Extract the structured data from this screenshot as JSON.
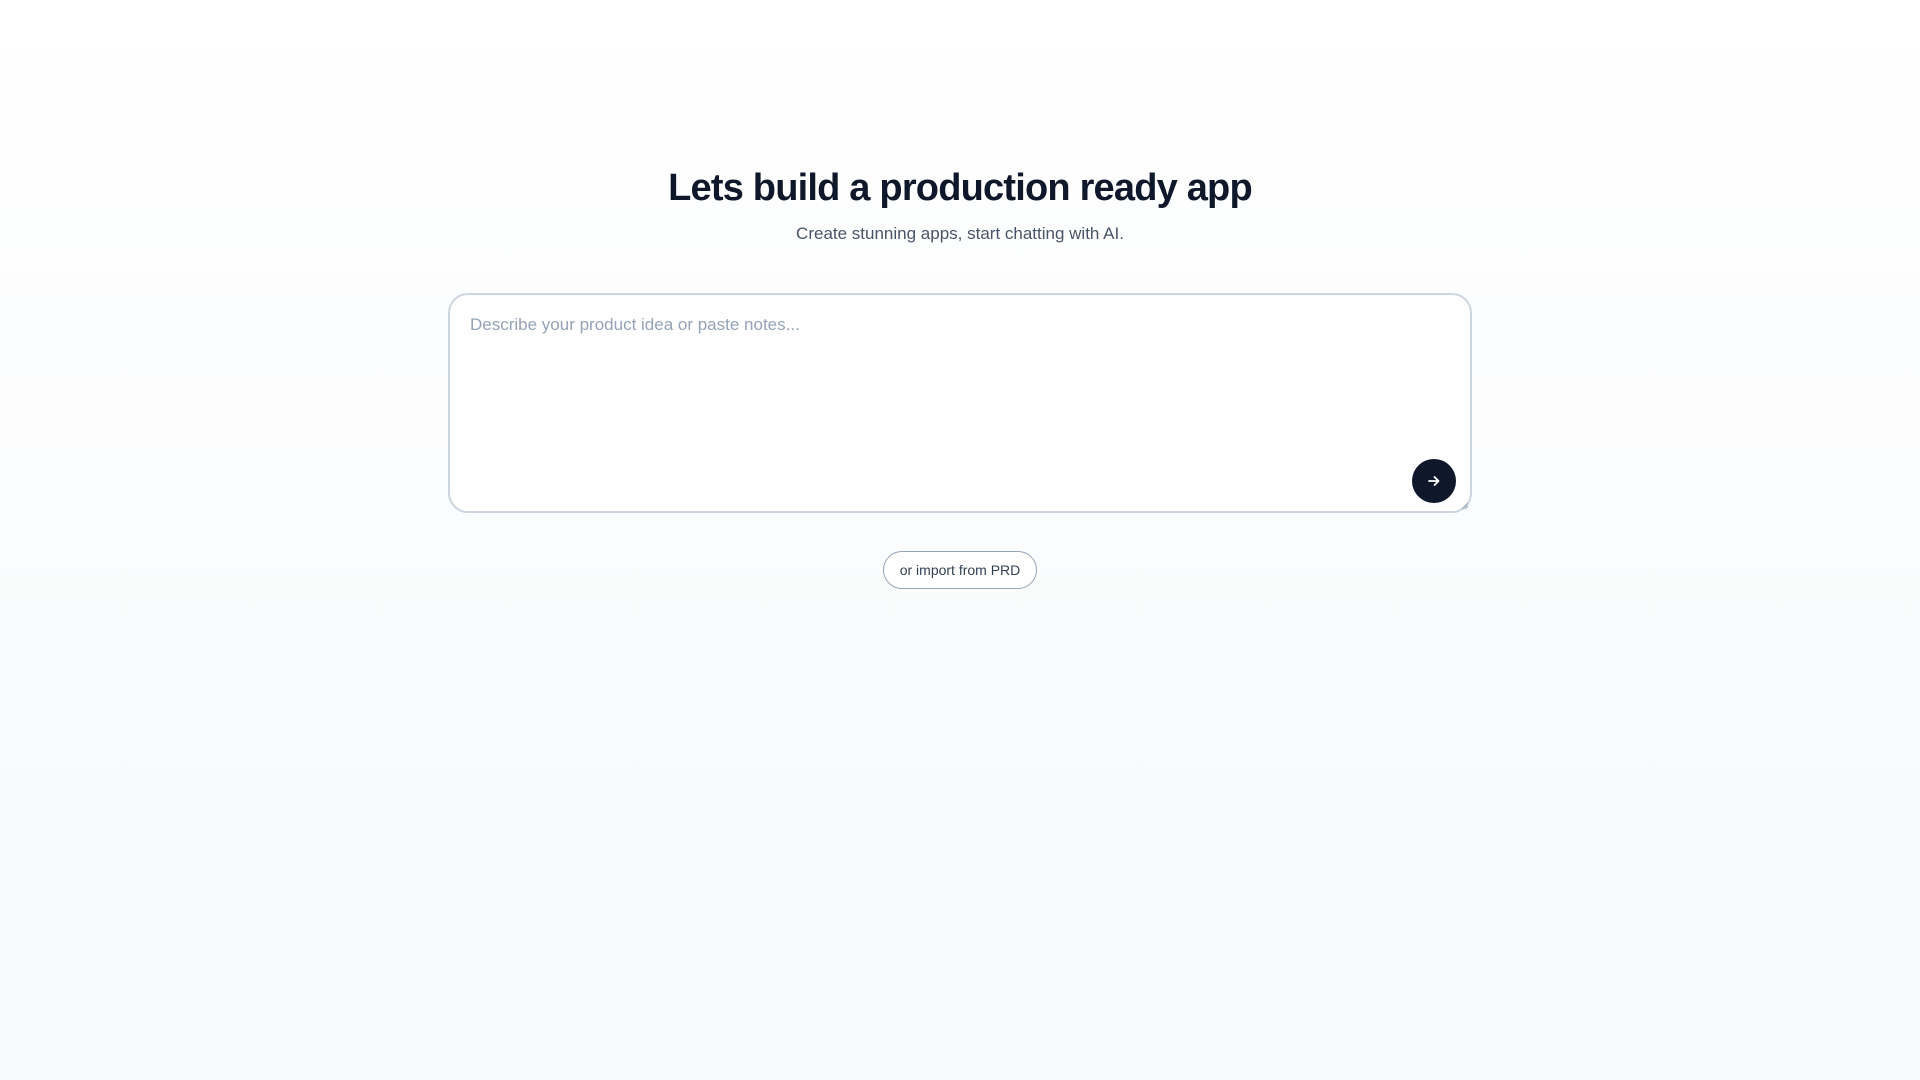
{
  "hero": {
    "title": "Lets build a production ready app",
    "subtitle": "Create stunning apps, start chatting with AI."
  },
  "composer": {
    "placeholder": "Describe your product idea or paste notes...",
    "value": "",
    "send_icon": "arrow-right-icon"
  },
  "import": {
    "label": "or import from PRD"
  },
  "colors": {
    "primary": "#0f172a",
    "muted_text": "#475569",
    "placeholder": "#94a3b8",
    "border": "#cdd5e0"
  }
}
